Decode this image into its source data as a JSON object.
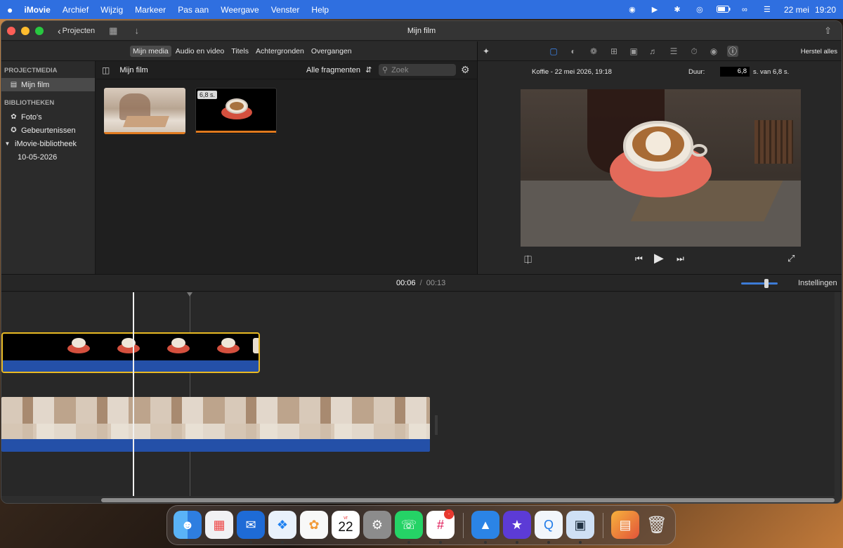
{
  "menubar": {
    "apple": "",
    "app": "iMovie",
    "menus": [
      "Archief",
      "Wijzig",
      "Markeer",
      "Pas aan",
      "Weergave",
      "Venster",
      "Help"
    ],
    "date": "22 mei",
    "time": "19:20"
  },
  "window": {
    "title": "Mijn film",
    "projects_label": "Projecten"
  },
  "media_tabs": [
    "Mijn media",
    "Audio en video",
    "Titels",
    "Achtergronden",
    "Overgangen"
  ],
  "sidebar": {
    "section_project": "PROJECTMEDIA",
    "project_item": "Mijn film",
    "section_libraries": "BIBLIOTHEKEN",
    "library_items": [
      "Foto's",
      "Gebeurtenissen"
    ],
    "library_name": "iMovie-bibliotheek",
    "event_item": "10-05-2026"
  },
  "content": {
    "name": "Mijn film",
    "filter": "Alle fragmenten",
    "search_placeholder": "Zoek",
    "clip_duration_badge": "6,8 s."
  },
  "viewer": {
    "reset_label": "Herstel alles",
    "clip_info": "Koffie - 22 mei 2026, 19:18",
    "duration_label": "Duur:",
    "duration_value": "6,8",
    "duration_suffix": "s. van 6,8 s."
  },
  "timeline": {
    "current_time": "00:06",
    "separator": "/",
    "total_time": "00:13",
    "settings_label": "Instellingen",
    "zoom_level": 0.72
  },
  "dock": {
    "calendar_month": "vr",
    "calendar_day": "22",
    "slack_badge": "·"
  },
  "colors": {
    "menubar": "#2f6fe0",
    "selection_yellow": "#e8b923",
    "audio_blue": "#2450a8",
    "accent_orange": "#e07a1f"
  }
}
